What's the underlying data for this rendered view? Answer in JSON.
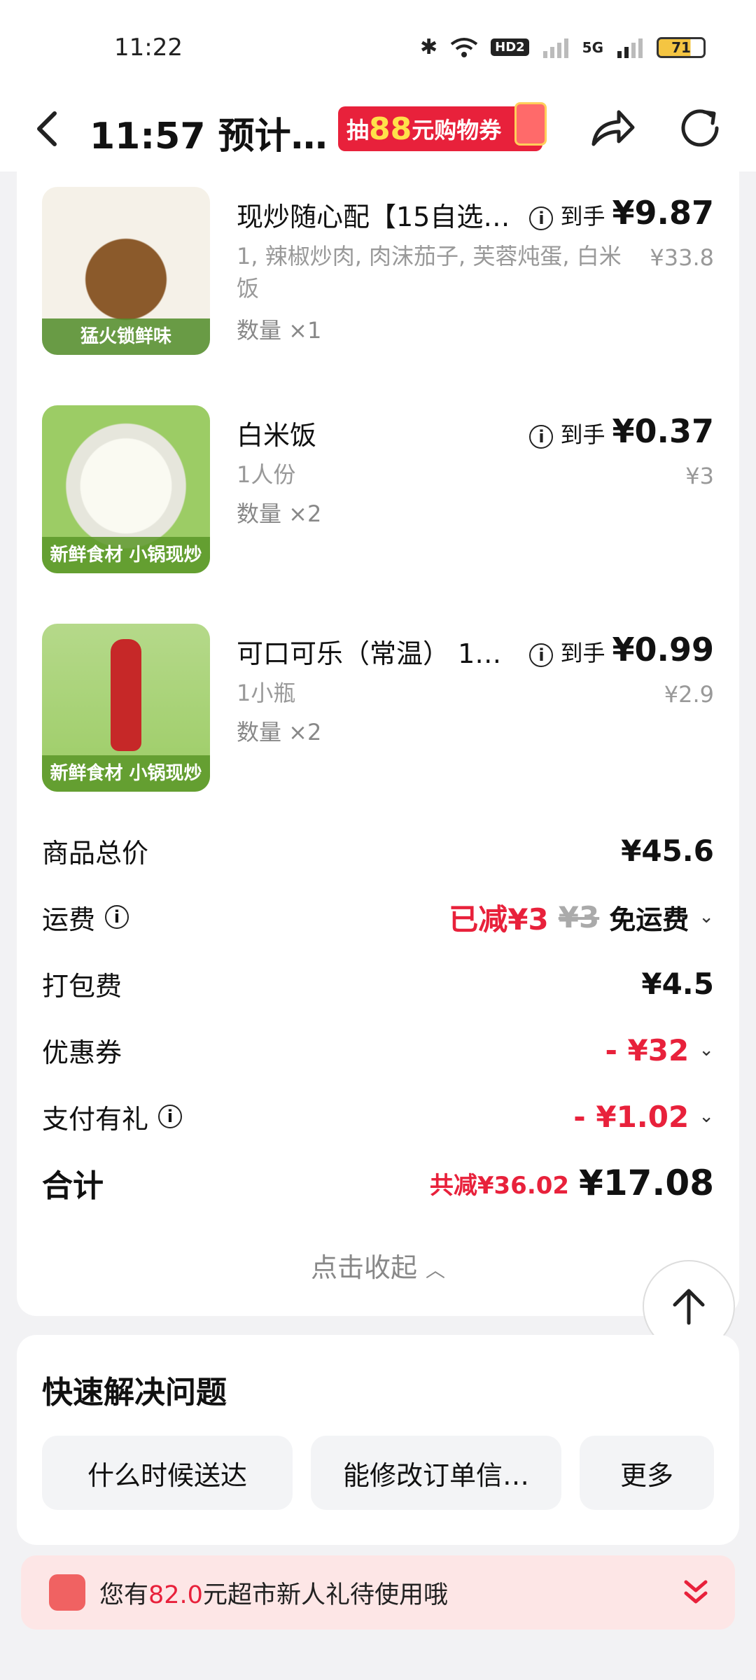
{
  "status_bar": {
    "time": "11:22",
    "network": "5G",
    "battery": "71",
    "hd_label": "HD2"
  },
  "header": {
    "title": "11:57 预计…",
    "promo": {
      "prefix": "抽",
      "amount": "88",
      "suffix": "元购物券"
    }
  },
  "items": [
    {
      "name": "现炒随心配【15自选…",
      "spec": "1, 辣椒炒肉, 肉沫茄子, 芙蓉炖蛋, 白米饭",
      "qty": "数量 ×1",
      "price_label": "到手",
      "price_final": "¥9.87",
      "price_original": "¥33.8",
      "thumb_tag": "猛火锁鲜味",
      "thumb_colors": [
        "#f5f1e8",
        "#8b5a2b"
      ]
    },
    {
      "name": "白米饭",
      "spec": "1人份",
      "qty": "数量 ×2",
      "price_label": "到手",
      "price_final": "¥0.37",
      "price_original": "¥3",
      "thumb_tag": "新鲜食材 小锅现炒",
      "thumb_colors": [
        "#f8f8f0",
        "#9ccc65"
      ]
    },
    {
      "name": "可口可乐（常温） 1…",
      "spec": "1小瓶",
      "qty": "数量 ×2",
      "price_label": "到手",
      "price_final": "¥0.99",
      "price_original": "¥2.9",
      "thumb_tag": "新鲜食材 小锅现炒",
      "thumb_colors": [
        "#c62828",
        "#9ccc65"
      ]
    }
  ],
  "summary": {
    "subtotal_label": "商品总价",
    "subtotal_value": "¥45.6",
    "delivery_label": "运费",
    "delivery_discount": "已减¥3",
    "delivery_original": "¥3",
    "delivery_value": "免运费",
    "packing_label": "打包费",
    "packing_value": "¥4.5",
    "coupon_label": "优惠券",
    "coupon_value": "- ¥32",
    "pay_gift_label": "支付有礼",
    "pay_gift_value": "- ¥1.02",
    "total_label": "合计",
    "total_saved": "共减¥36.02",
    "total_value": "¥17.08"
  },
  "collapse_label": "点击收起",
  "help": {
    "title": "快速解决问题",
    "buttons": [
      "什么时候送达",
      "能修改订单信…",
      "更多"
    ]
  },
  "banner": {
    "prefix": "您有",
    "amount": "82.0",
    "suffix": "元超市新人礼待使用哦"
  },
  "colors": {
    "accent_red": "#e8213b",
    "card_bg": "#ffffff",
    "page_bg": "#f2f2f4"
  }
}
